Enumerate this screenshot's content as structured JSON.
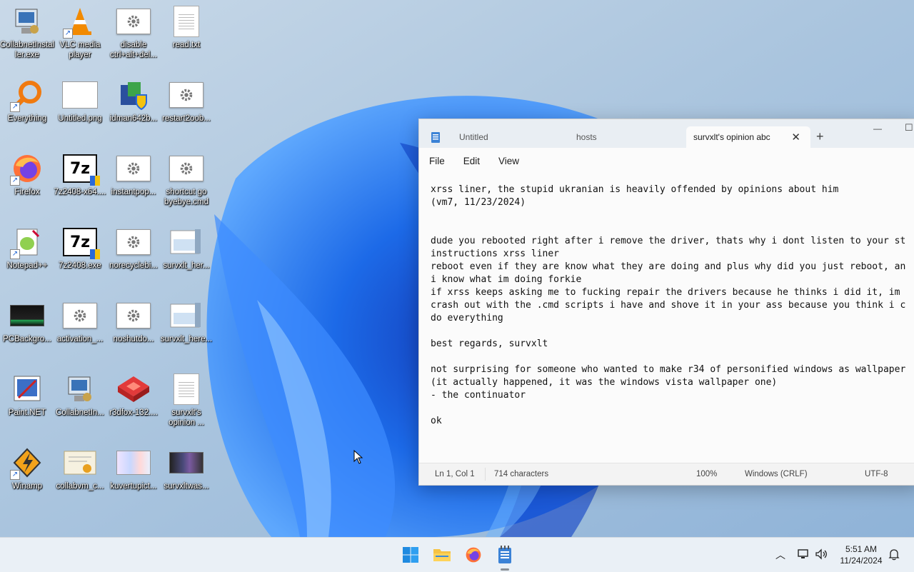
{
  "desktop": {
    "icons": [
      {
        "label": "CollabnetInstaller.exe"
      },
      {
        "label": "VLC media player"
      },
      {
        "label": "disable ctrl+alt+del..."
      },
      {
        "label": "read.txt"
      },
      {
        "label": "Everything"
      },
      {
        "label": "Untitled.png"
      },
      {
        "label": "idman642b..."
      },
      {
        "label": "restart2oob..."
      },
      {
        "label": "Firefox"
      },
      {
        "label": "7z2408-x64...."
      },
      {
        "label": "instantpop..."
      },
      {
        "label": "shortcut go byebye.cmd"
      },
      {
        "label": "Notepad++"
      },
      {
        "label": "7z2408.exe"
      },
      {
        "label": "norecyclebi..."
      },
      {
        "label": "survxlt_her..."
      },
      {
        "label": "PCBackgro..."
      },
      {
        "label": "activation_..."
      },
      {
        "label": "noshutdo..."
      },
      {
        "label": "survxlt_here..."
      },
      {
        "label": "Paint.NET"
      },
      {
        "label": "CollabnetIn..."
      },
      {
        "label": "r3dfox-132...."
      },
      {
        "label": "survxlt's opinion ..."
      },
      {
        "label": "Winamp"
      },
      {
        "label": "collabvm_c..."
      },
      {
        "label": "kuvertupict..."
      },
      {
        "label": "survxltwas..."
      }
    ]
  },
  "notepad": {
    "tabs": [
      {
        "label": "Untitled"
      },
      {
        "label": "hosts"
      },
      {
        "label": "survxlt's opinion abc"
      }
    ],
    "menu": {
      "file": "File",
      "edit": "Edit",
      "view": "View"
    },
    "content_lines": [
      "xrss liner, the stupid ukranian is heavily offended by opinions about him",
      "(vm7, 11/23/2024)",
      "",
      "",
      "dude you rebooted right after i remove the driver, thats why i dont listen to your st",
      "instructions xrss liner",
      "reboot even if they are know what they are doing and plus why did you just reboot, an",
      "i know what im doing forkie",
      "if xrss keeps asking me to fucking repair the drivers because he thinks i did it, im",
      "crash out with the .cmd scripts i have and shove it in your ass because you think i c",
      "do everything",
      "",
      "best regards, survxlt",
      "",
      "not surprising for someone who wanted to make r34 of personified windows as wallpaper",
      "(it actually happened, it was the windows vista wallpaper one)",
      "- the continuator",
      "",
      "ok"
    ],
    "status": {
      "position": "Ln 1, Col 1",
      "characters": "714 characters",
      "zoom": "100%",
      "line_ending": "Windows (CRLF)",
      "encoding": "UTF-8"
    },
    "window_controls": {
      "minimize": "—",
      "maximize": "☐"
    }
  },
  "taskbar": {
    "apps": [
      "start-icon",
      "file-explorer-icon",
      "firefox-icon",
      "notepad-icon"
    ],
    "time": "5:51 AM",
    "date": "11/24/2024",
    "tray_icons": [
      "chevron-up-icon",
      "network-icon",
      "volume-icon",
      "notification-bell-icon"
    ]
  },
  "colors": {
    "accent": "#0067c0",
    "wallpaper_bloom": "#1565e8"
  }
}
